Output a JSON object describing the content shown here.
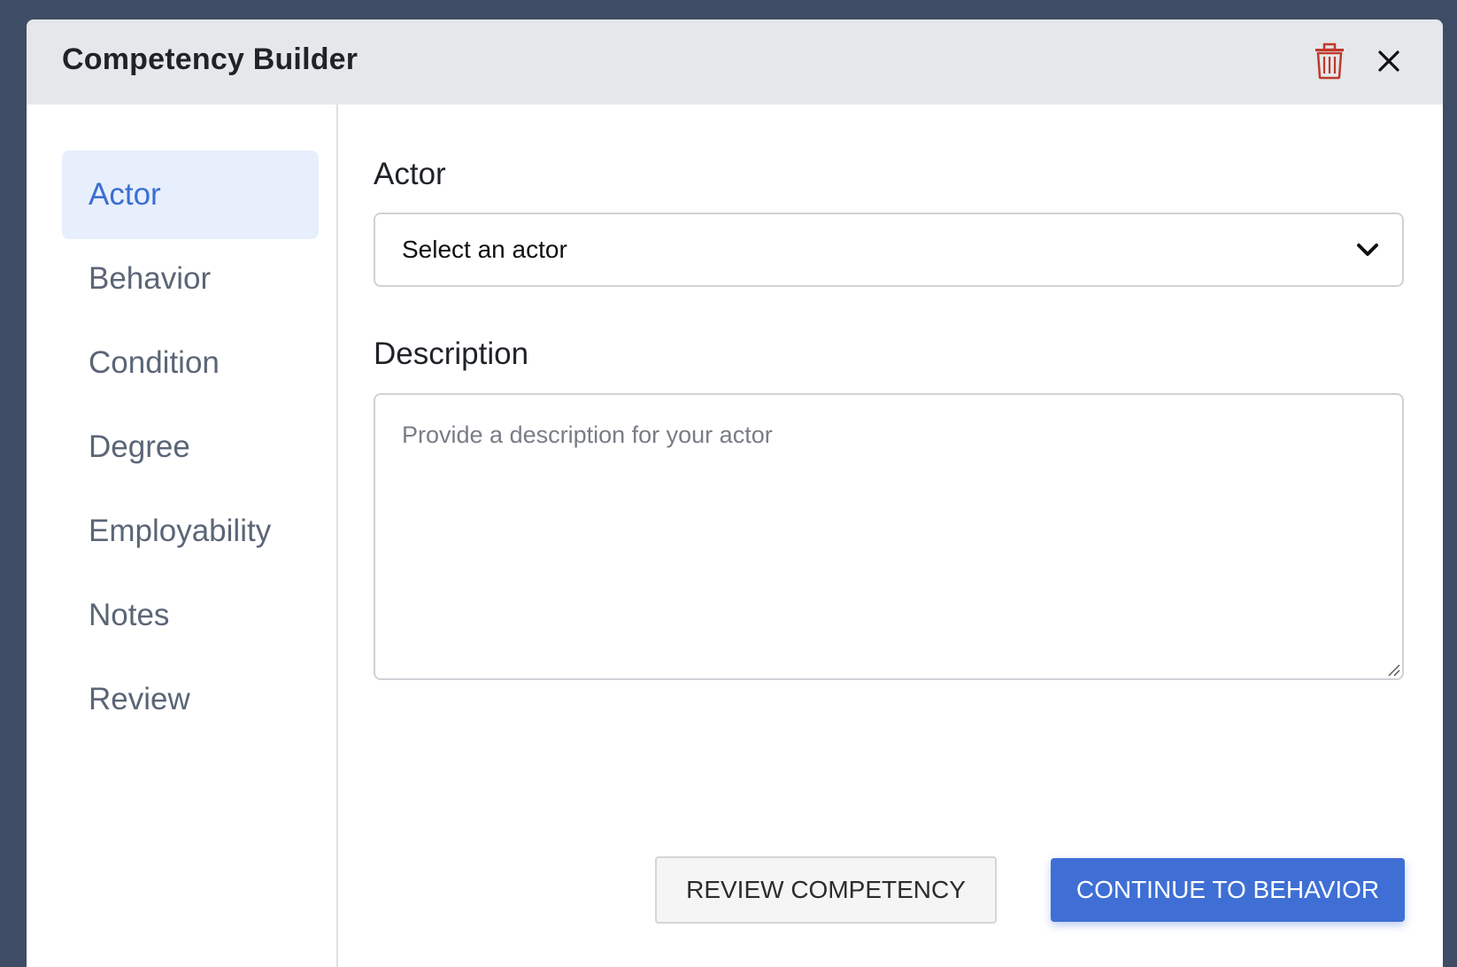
{
  "modal": {
    "title": "Competency Builder"
  },
  "header_icons": {
    "delete": "trash-icon",
    "close": "close-icon",
    "delete_color": "#c0392b"
  },
  "sidebar": {
    "items": [
      {
        "label": "Actor",
        "active": true
      },
      {
        "label": "Behavior",
        "active": false
      },
      {
        "label": "Condition",
        "active": false
      },
      {
        "label": "Degree",
        "active": false
      },
      {
        "label": "Employability",
        "active": false
      },
      {
        "label": "Notes",
        "active": false
      },
      {
        "label": "Review",
        "active": false
      }
    ]
  },
  "form": {
    "actor_label": "Actor",
    "actor_select_value": "Select an actor",
    "description_label": "Description",
    "description_placeholder": "Provide a description for your actor"
  },
  "footer": {
    "review_button": "REVIEW COMPETENCY",
    "continue_button": "CONTINUE TO BEHAVIOR"
  },
  "colors": {
    "accent": "#3f6fd4",
    "active_nav_bg": "#e7effd",
    "header_bg": "#e5e7eb",
    "backdrop": "#3e4d65"
  }
}
